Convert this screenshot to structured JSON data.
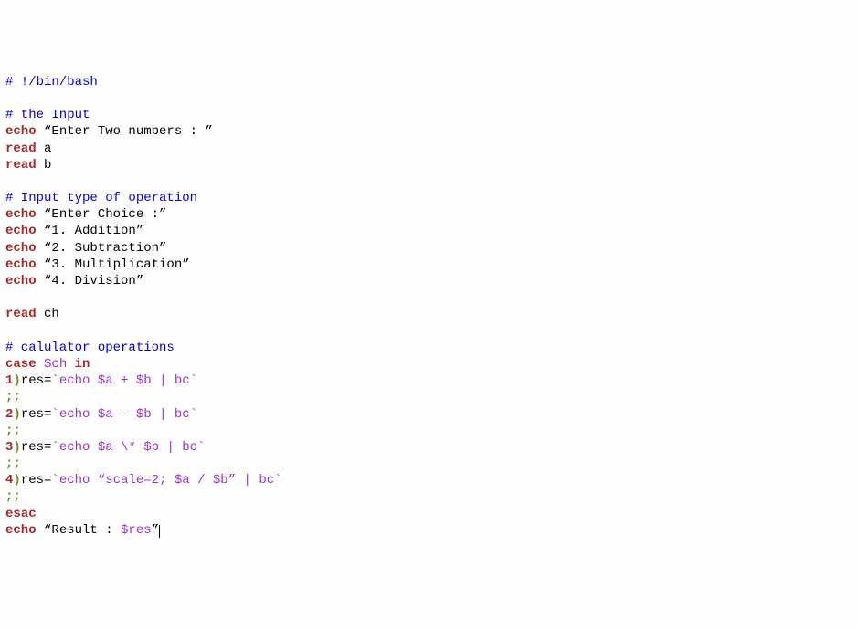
{
  "lines": {
    "l1_comment": "# !/bin/bash",
    "l3_comment": "# the Input",
    "l4_kw": "echo",
    "l4_str": " “Enter Two numbers : ”",
    "l5_kw": "read",
    "l5_arg": " a",
    "l6_kw": "read",
    "l6_arg": " b",
    "l8_comment": "# Input type of operation",
    "l9_kw": "echo",
    "l9_str": " “Enter Choice :”",
    "l10_kw": "echo",
    "l10_str": " “1. Addition”",
    "l11_kw": "echo",
    "l11_str": " “2. Subtraction”",
    "l12_kw": "echo",
    "l12_str": " “3. Multiplication”",
    "l13_kw": "echo",
    "l13_str": " “4. Division”",
    "l15_kw": "read",
    "l15_arg": " ch",
    "l17_comment": "# calulator operations",
    "l18_kw1": "case",
    "l18_var": " $ch ",
    "l18_kw2": "in",
    "l19_num": "1",
    "l19_paren": ")",
    "l19_res": "res=",
    "l19_bt1": "`",
    "l19_echo": "echo ",
    "l19_va": "$a",
    "l19_op": " + ",
    "l19_vb": "$b",
    "l19_pipe": " | bc",
    "l19_bt2": "`",
    "l20_semi": ";;",
    "l21_num": "2",
    "l21_paren": ")",
    "l21_res": "res=",
    "l21_bt1": "`",
    "l21_echo": "echo ",
    "l21_va": "$a",
    "l21_op": " - ",
    "l21_vb": "$b",
    "l21_pipe": " | bc",
    "l21_bt2": "`",
    "l22_semi": ";;",
    "l23_num": "3",
    "l23_paren": ")",
    "l23_res": "res=",
    "l23_bt1": "`",
    "l23_echo": "echo ",
    "l23_va": "$a",
    "l23_op": " \\* ",
    "l23_vb": "$b",
    "l23_pipe": " | bc",
    "l23_bt2": "`",
    "l24_semi": ";;",
    "l25_num": "4",
    "l25_paren": ")",
    "l25_res": "res=",
    "l25_bt1": "`",
    "l25_echo": "echo ",
    "l25_q1": "“",
    "l25_scale": "scale=2; ",
    "l25_va": "$a",
    "l25_op": " / ",
    "l25_vb": "$b",
    "l25_q2": "”",
    "l25_pipe": " | bc",
    "l25_bt2": "`",
    "l26_semi": ";;",
    "l27_kw": "esac",
    "l28_kw": "echo",
    "l28_q1": " “Result : ",
    "l28_var": "$res",
    "l28_q2": "”"
  }
}
